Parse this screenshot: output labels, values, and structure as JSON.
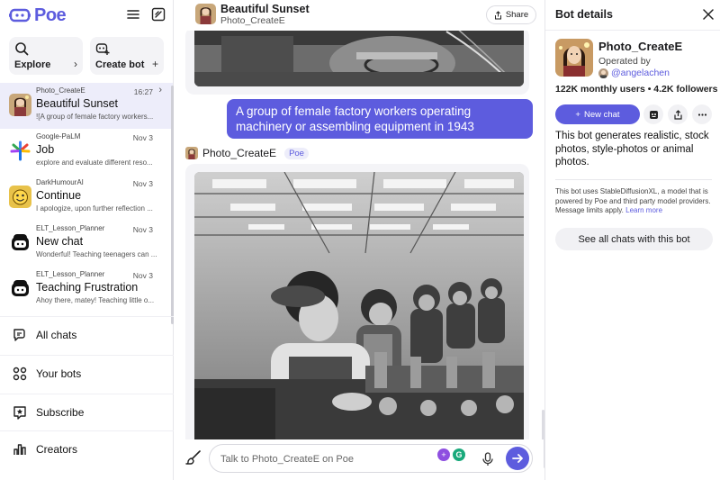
{
  "app": {
    "name": "Poe",
    "accent": "#5d5cde"
  },
  "sidebar": {
    "quick": [
      {
        "label": "Explore",
        "icon": "search-icon",
        "action": "›"
      },
      {
        "label": "Create bot",
        "icon": "bot-add-icon",
        "action": "+"
      }
    ],
    "chats": [
      {
        "bot": "Photo_CreateE",
        "title": "Beautiful Sunset",
        "preview": "![A group of female factory workers...",
        "date": "16:27",
        "active": true
      },
      {
        "bot": "Google-PaLM",
        "title": "Job",
        "preview": "explore and evaluate different reso...",
        "date": "Nov 3"
      },
      {
        "bot": "DarkHumourAI",
        "title": "Continue",
        "preview": "I apologize, upon further reflection ...",
        "date": "Nov 3"
      },
      {
        "bot": "ELT_Lesson_Planner",
        "title": "New chat",
        "preview": "Wonderful! Teaching teenagers can ...",
        "date": "Nov 3"
      },
      {
        "bot": "ELT_Lesson_Planner",
        "title": "Teaching Frustration",
        "preview": "Ahoy there, matey! Teaching little o...",
        "date": "Nov 3"
      }
    ],
    "nav": [
      {
        "label": "All chats",
        "icon": "chats-icon"
      },
      {
        "label": "Your bots",
        "icon": "grid-icon"
      },
      {
        "label": "Subscribe",
        "icon": "star-icon"
      },
      {
        "label": "Creators",
        "icon": "chart-icon"
      }
    ]
  },
  "conversation": {
    "title": "Beautiful Sunset",
    "bot": "Photo_CreateE",
    "share_label": "Share",
    "user_message": "A group of female factory workers operating machinery or assembling equipment in 1943",
    "reply_bot": "Photo_CreateE",
    "reply_tag": "Poe",
    "input_placeholder": "Talk to Photo_CreateE on Poe",
    "input_plus": "+",
    "input_g": "G"
  },
  "details": {
    "heading": "Bot details",
    "name": "Photo_CreateE",
    "operated_by": "Operated by",
    "handle": "@angelachen",
    "stats": "122K monthly users  •  4.2K followers",
    "new_chat": "New chat",
    "description": "This bot generates realistic, stock photos, style-photos or animal photos.",
    "powered": "This bot uses StableDiffusionXL, a model that is powered by Poe and third party model providers. Message limits apply.",
    "learn_more": "Learn more",
    "see_all": "See all chats with this bot"
  }
}
